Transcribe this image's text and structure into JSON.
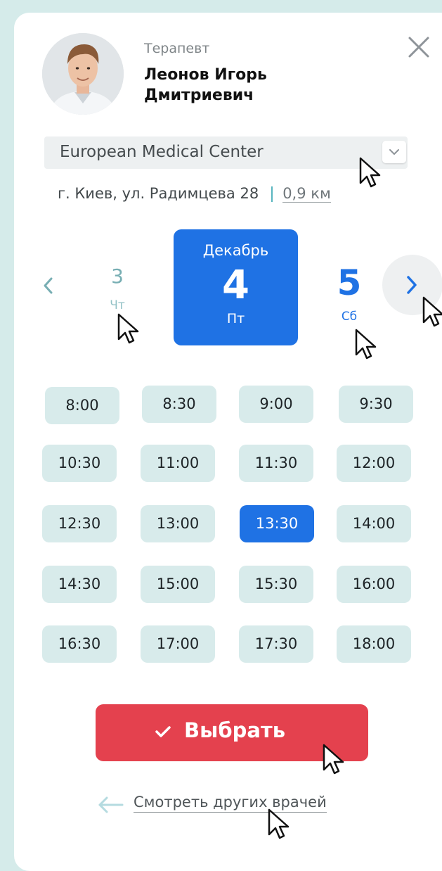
{
  "doctor": {
    "role": "Терапевт",
    "name": "Леонов Игорь Дмитриевич"
  },
  "clinic_select": {
    "value": "European Medical Center"
  },
  "address": {
    "text": "г. Киев, ул. Радимцева 28",
    "distance": "0,9 км"
  },
  "dates": {
    "prev": {
      "day": "3",
      "weekday": "Чт"
    },
    "active": {
      "month": "Декабрь",
      "day": "4",
      "weekday": "Пт"
    },
    "next": {
      "day": "5",
      "weekday": "Сб"
    }
  },
  "time_slots": [
    [
      "8:00",
      "8:30",
      "9:00",
      "9:30"
    ],
    [
      "10:30",
      "11:00",
      "11:30",
      "12:00"
    ],
    [
      "12:30",
      "13:00",
      "13:30",
      "14:00"
    ],
    [
      "14:30",
      "15:00",
      "15:30",
      "16:00"
    ],
    [
      "16:30",
      "17:00",
      "17:30",
      "18:00"
    ]
  ],
  "selected_slot": "13:30",
  "actions": {
    "choose_label": "Выбрать",
    "other_doctors_label": "Смотреть других врачей"
  },
  "colors": {
    "accent_blue": "#1f72e4",
    "action_red": "#e4414e",
    "slot_bg": "#d8ebeb",
    "page_bg": "#d5ebea"
  }
}
